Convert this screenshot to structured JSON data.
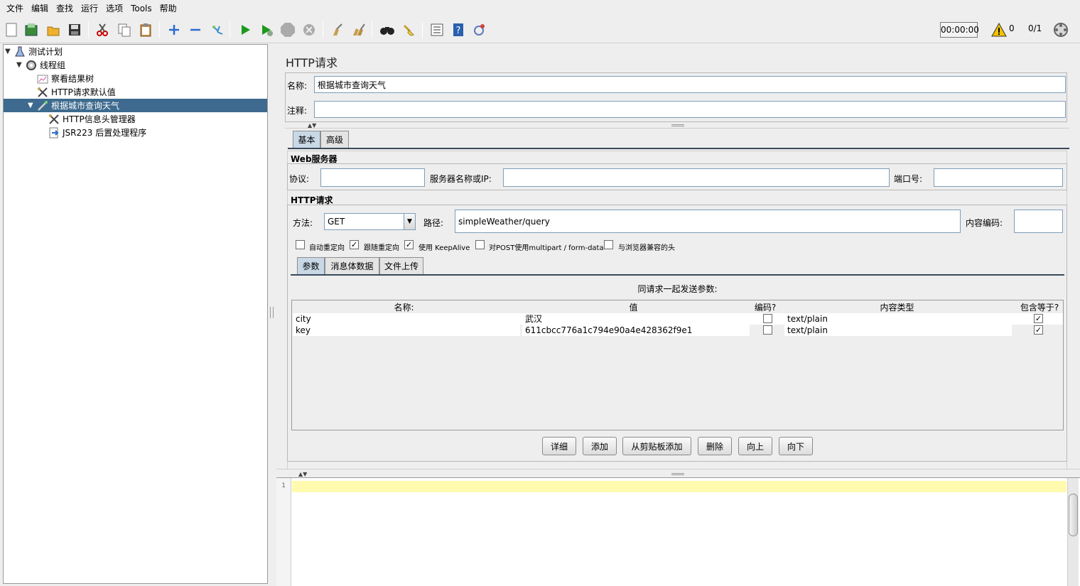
{
  "menu": [
    "文件",
    "编辑",
    "查找",
    "运行",
    "选项",
    "Tools",
    "帮助"
  ],
  "toolbar": {
    "icons": [
      "new-icon",
      "templates-icon",
      "open-icon",
      "save-icon",
      "cut-icon",
      "copy-icon",
      "paste-icon",
      "expand-icon",
      "collapse-icon",
      "toggle-icon",
      "start-icon",
      "start-no-pause-icon",
      "stop-icon",
      "shutdown-icon",
      "clear-icon",
      "clear-all-icon",
      "search-icon",
      "reset-search-icon",
      "function-helper-icon",
      "help-icon",
      "remote-icon"
    ],
    "timer": "00:00:00",
    "warnings": "0",
    "threads": "0/1"
  },
  "tree": {
    "items": [
      {
        "label": "测试计划",
        "icon": "test-plan-icon"
      },
      {
        "label": "线程组",
        "icon": "thread-group-icon"
      },
      {
        "label": "察看结果树",
        "icon": "results-tree-icon"
      },
      {
        "label": "HTTP请求默认值",
        "icon": "config-icon"
      },
      {
        "label": "根据城市查询天气",
        "icon": "sampler-icon"
      },
      {
        "label": "HTTP信息头管理器",
        "icon": "config-icon"
      },
      {
        "label": "JSR223 后置处理程序",
        "icon": "postprocessor-icon"
      }
    ]
  },
  "panel": {
    "title": "HTTP请求",
    "name_label": "名称:",
    "name_value": "根据城市查询天气",
    "comment_label": "注释:",
    "comment_value": "",
    "tabs": [
      "基本",
      "高级"
    ],
    "web_server_title": "Web服务器",
    "protocol_label": "协议:",
    "protocol_value": "",
    "server_label": "服务器名称或IP:",
    "server_value": "",
    "port_label": "端口号:",
    "port_value": "",
    "http_request_title": "HTTP请求",
    "method_label": "方法:",
    "method_value": "GET",
    "path_label": "路径:",
    "path_value": "simpleWeather/query",
    "encoding_label": "内容编码:",
    "encoding_value": "",
    "options": [
      {
        "label": "自动重定向",
        "checked": false
      },
      {
        "label": "跟随重定向",
        "checked": true
      },
      {
        "label": "使用 KeepAlive",
        "checked": true
      },
      {
        "label": "对POST使用multipart / form-data",
        "checked": false
      },
      {
        "label": "与浏览器兼容的头",
        "checked": false
      }
    ],
    "subtabs": [
      "参数",
      "消息体数据",
      "文件上传"
    ],
    "params_caption": "同请求一起发送参数:",
    "columns": [
      "名称:",
      "值",
      "编码?",
      "内容类型",
      "包含等于?"
    ],
    "rows": [
      {
        "name": "city",
        "value": "武汉",
        "encode": false,
        "content_type": "text/plain",
        "include_equals": true
      },
      {
        "name": "key",
        "value": "611cbcc776a1c794e90a4e428362f9e1",
        "encode": false,
        "content_type": "text/plain",
        "include_equals": true
      }
    ],
    "buttons": [
      "详细",
      "添加",
      "从剪贴板添加",
      "删除",
      "向上",
      "向下"
    ]
  },
  "editor": {
    "line_number": "1"
  }
}
